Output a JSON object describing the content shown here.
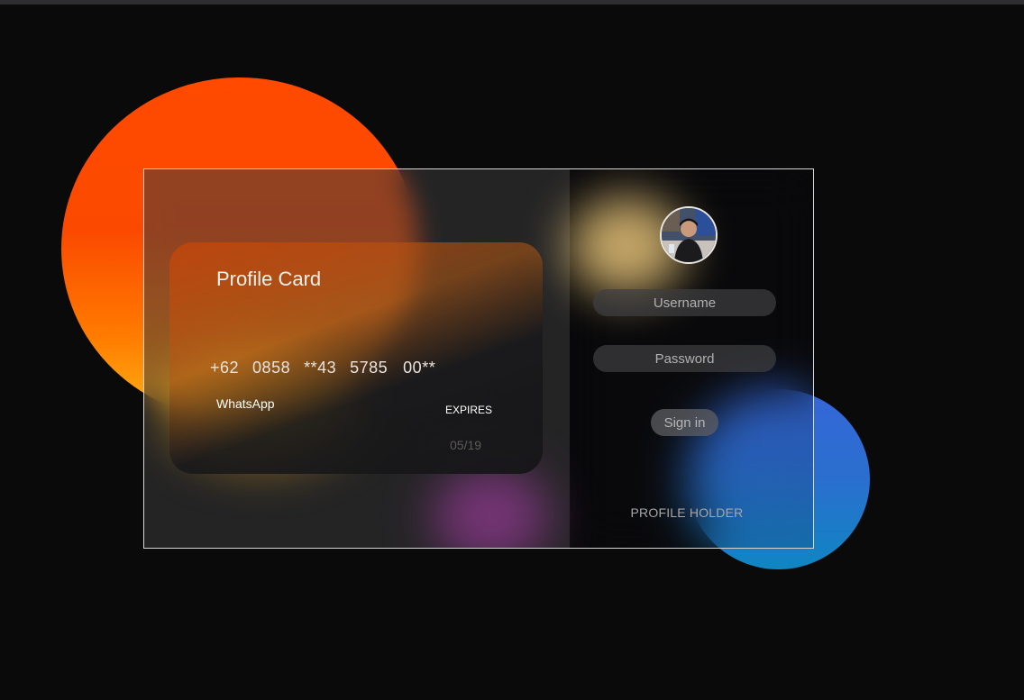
{
  "card": {
    "title": "Profile Card",
    "number_groups": [
      "+62",
      "0858",
      "**43",
      "5785",
      "00**"
    ],
    "brand": "WhatsApp",
    "expires_label": "EXPIRES",
    "expires_value": "05/19"
  },
  "login": {
    "username_placeholder": "Username",
    "password_placeholder": "Password",
    "signin_label": "Sign in",
    "holder_label": "PROFILE HOLDER"
  },
  "colors": {
    "background": "#0a0a0b",
    "orange_circle": "#fb4a00",
    "blue_circle": "#2a6fcf",
    "frame_border": "#d6d6d6"
  },
  "icons": {
    "avatar": "profile-photo"
  }
}
